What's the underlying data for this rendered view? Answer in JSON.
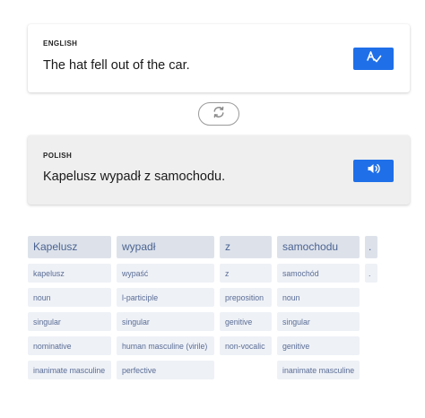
{
  "source": {
    "language_label": "ENGLISH",
    "text": "The hat fell out of the car."
  },
  "target": {
    "language_label": "POLISH",
    "text": "Kapelusz wypadł z samochodu."
  },
  "icons": {
    "source_action": "spellcheck-icon",
    "swap": "swap-refresh-icon",
    "target_action": "speaker-icon"
  },
  "colors": {
    "accent": "#1f6fe8",
    "word_header_bg": "#dde2ea",
    "word_header_text": "#4b6392",
    "cell_bg": "#eef1f6",
    "cell_text": "#5a6d96"
  },
  "words": [
    {
      "word": "Kapelusz",
      "details": [
        "kapelusz",
        "noun",
        "singular",
        "nominative",
        "inanimate masculine"
      ]
    },
    {
      "word": "wypadł",
      "details": [
        "wypaść",
        "l-participle",
        "singular",
        "human masculine (virile)",
        "perfective"
      ]
    },
    {
      "word": "z",
      "details": [
        "z",
        "preposition",
        "genitive",
        "non-vocalic"
      ]
    },
    {
      "word": "samochodu",
      "details": [
        "samochód",
        "noun",
        "singular",
        "genitive",
        "inanimate masculine"
      ]
    },
    {
      "word": ".",
      "details": [
        "."
      ]
    }
  ]
}
